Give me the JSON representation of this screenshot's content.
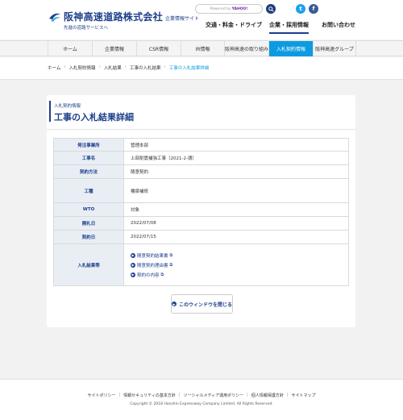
{
  "header": {
    "logo_main": "阪神高速道路株式会社",
    "logo_sub": "企業情報サイト",
    "logo_tagline": "先進の道路サービスへ",
    "search_label": "Powered by",
    "search_brand": "YAHOO!",
    "twitter_glyph": "t",
    "facebook_glyph": "f",
    "nav": [
      "交通・料金・ドライブ",
      "企業・採用情報",
      "お問い合わせ"
    ],
    "active_nav": "企業・採用情報"
  },
  "menu": {
    "items": [
      "ホーム",
      "企業情報",
      "CSR情報",
      "IR情報",
      "阪神高速の取り組み",
      "入札契約情報",
      "阪神高速グループ"
    ],
    "active": "入札契約情報"
  },
  "breadcrumb": [
    "ホーム",
    "入札契約情報",
    "入札結果",
    "工事の入札結果",
    "工事の入札結果詳細"
  ],
  "page": {
    "category": "入札契約情報",
    "title": "工事の入札結果詳細"
  },
  "table": {
    "rows": [
      {
        "label": "発注事業所",
        "value": "管理本部"
      },
      {
        "label": "工事名",
        "value": "上部耐震補強工事（2021-2-環）"
      },
      {
        "label": "契約方法",
        "value": "随意契約"
      },
      {
        "label": "工種",
        "value": "橋梁補修"
      },
      {
        "label": "WTO",
        "value": "対象"
      },
      {
        "label": "開札日",
        "value": "2022/07/08"
      },
      {
        "label": "契約日",
        "value": "2022/07/15"
      }
    ],
    "results_label": "入札結果等",
    "result_links": [
      "随意契約結果書",
      "随意契約理由書",
      "契約の内容"
    ]
  },
  "close_button": "このウィンドウを閉じる",
  "footer": {
    "links": [
      "サイトポリシー",
      "情報セキュリティの基本方針",
      "ソーシャルメディア運用ポリシー",
      "個人情報保護方針",
      "サイトマップ"
    ],
    "copyright": "Copyright © 2018 Hanshin Expressway Company Limited. All Rights Reserved."
  }
}
